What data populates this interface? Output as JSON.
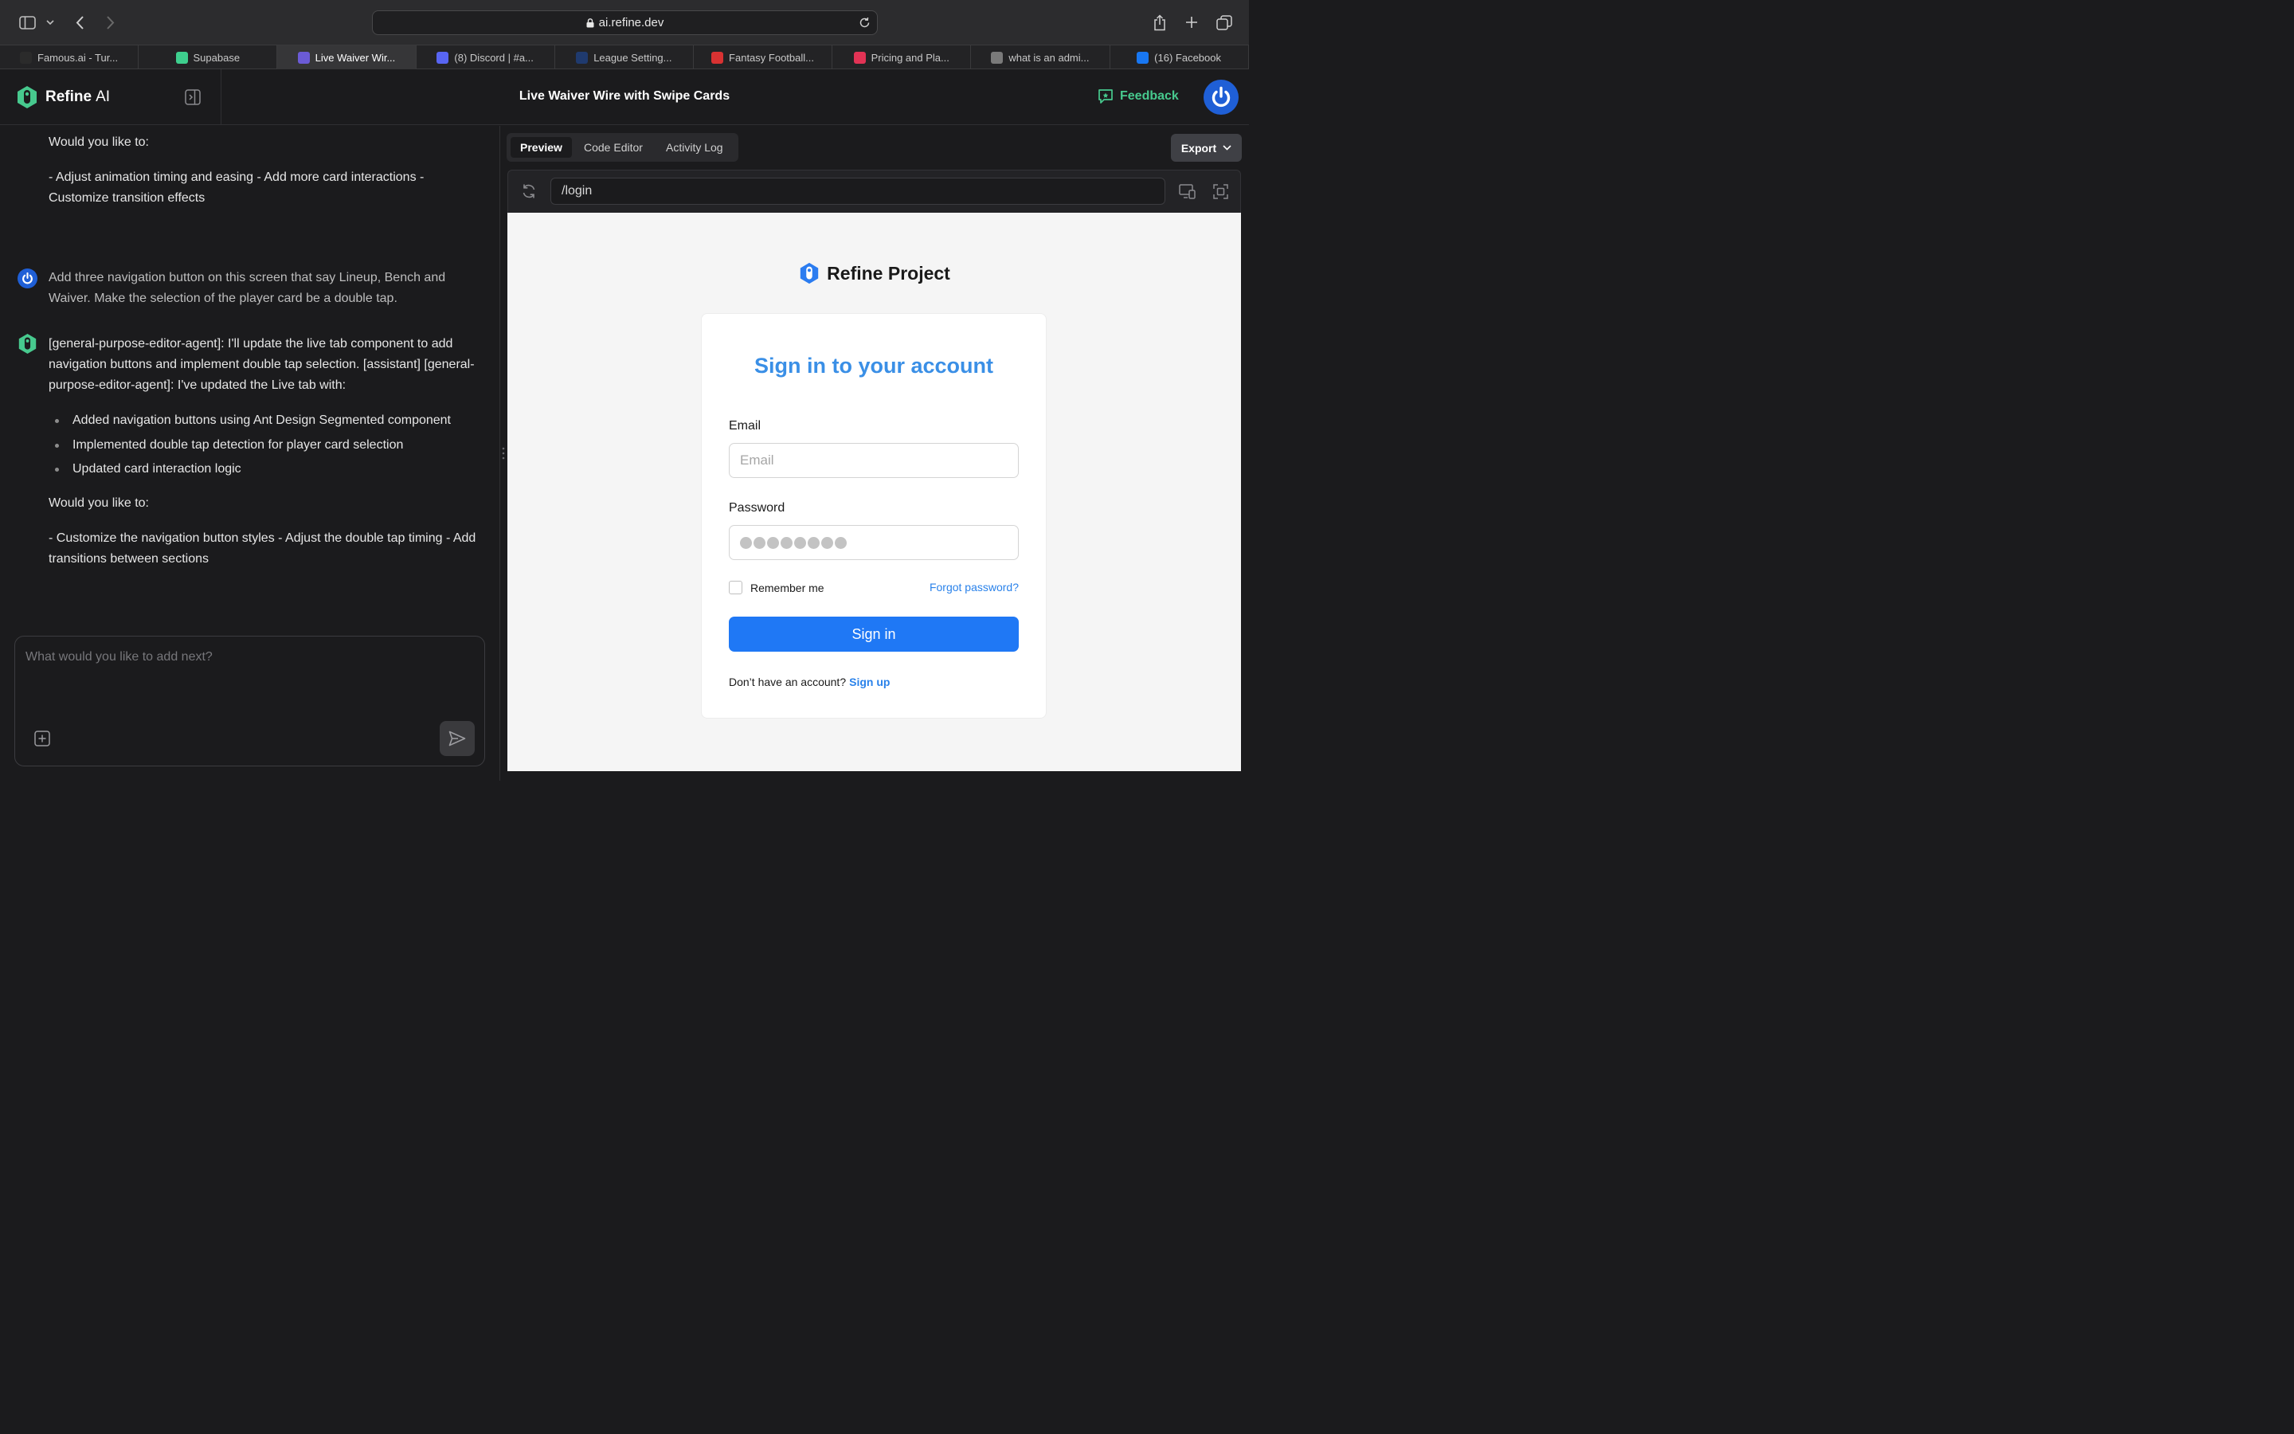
{
  "browser": {
    "url": "ai.refine.dev",
    "tabs": [
      {
        "label": "Famous.ai - Tur...",
        "icon": "rocket-icon",
        "color": "#2b2b2b"
      },
      {
        "label": "Supabase",
        "icon": "supabase-icon",
        "color": "#3ecf8e"
      },
      {
        "label": "Live Waiver Wir...",
        "icon": "refine-swirl-icon",
        "color": "#6b5bd6"
      },
      {
        "label": "(8) Discord | #a...",
        "icon": "discord-icon",
        "color": "#5865f2"
      },
      {
        "label": "League Setting...",
        "icon": "nfl-shield-icon",
        "color": "#1f3a6e"
      },
      {
        "label": "Fantasy Football...",
        "icon": "nfl-icon",
        "color": "#d83232"
      },
      {
        "label": "Pricing and Pla...",
        "icon": "pricing-icon",
        "color": "#e23355"
      },
      {
        "label": "what is an admi...",
        "icon": "g-icon",
        "color": "#7a7a7a"
      },
      {
        "label": "(16) Facebook",
        "icon": "facebook-icon",
        "color": "#1877f2"
      }
    ],
    "active_tab": 2
  },
  "app": {
    "brand_bold": "Refine",
    "brand_rest": "AI",
    "title": "Live Waiver Wire with Swipe Cards",
    "feedback_label": "Feedback",
    "accent": "#47c98e"
  },
  "chat": {
    "block1_heading": "Would you like to:",
    "block1_text": "- Adjust animation timing and easing - Add more card interactions - Customize transition effects",
    "user_message": "Add three navigation button on this screen that say Lineup, Bench and Waiver. Make the selection of the player card be a double tap.",
    "agent_message": "[general-purpose-editor-agent]: I'll update the live tab component to add navigation buttons and implement double tap selection. [assistant] [general-purpose-editor-agent]: I've updated the Live tab with:",
    "bullets": [
      "Added navigation buttons using Ant Design Segmented component",
      "Implemented double tap detection for player card selection",
      "Updated card interaction logic"
    ],
    "block2_heading": "Would you like to:",
    "block2_text": "- Customize the navigation button styles - Adjust the double tap timing - Add transitions between sections",
    "composer_placeholder": "What would you like to add next?"
  },
  "preview": {
    "tabs": [
      "Preview",
      "Code Editor",
      "Activity Log"
    ],
    "active_tab": "Preview",
    "export_label": "Export",
    "path": "/login",
    "project_name": "Refine Project",
    "card_title": "Sign in to your account",
    "email_label": "Email",
    "email_placeholder": "Email",
    "password_label": "Password",
    "password_masked_count": 8,
    "remember_label": "Remember me",
    "forgot_label": "Forgot password?",
    "signin_label": "Sign in",
    "no_account": "Don’t have an account?",
    "signup_label": "Sign up",
    "primary_color": "#1f78f5",
    "title_color": "#3a8fe6"
  }
}
